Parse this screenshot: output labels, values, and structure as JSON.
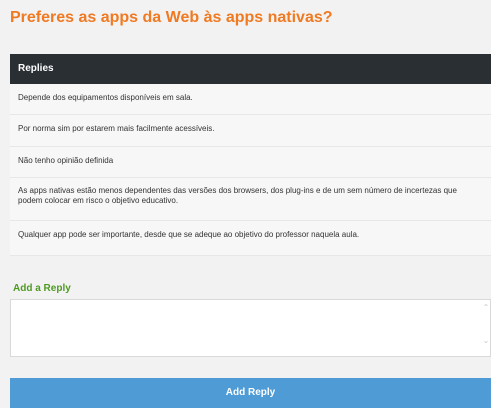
{
  "question": {
    "title": "Preferes as apps da Web às apps nativas?"
  },
  "replies": {
    "header": "Replies",
    "items": [
      {
        "text": "Depende dos equipamentos disponíveis em sala."
      },
      {
        "text": "Por norma sim por estarem mais facilmente acessíveis."
      },
      {
        "text": "Não tenho opinião definida"
      },
      {
        "text": "As apps nativas estão menos dependentes das versões dos browsers, dos plug-ins e de um sem número de incertezas que podem colocar em risco o objetivo educativo."
      },
      {
        "text": "Qualquer app pode ser importante, desde que se adeque ao objetivo do professor naquela aula."
      }
    ]
  },
  "form": {
    "label": "Add a Reply",
    "input_value": "",
    "button_label": "Add Reply"
  },
  "icons": {
    "scroll_up": "scroll-up-icon",
    "scroll_down": "scroll-down-icon"
  },
  "colors": {
    "title": "#f07a22",
    "header_bg": "#2a2f34",
    "label": "#4f9a23",
    "button_bg": "#4f9bd5"
  }
}
